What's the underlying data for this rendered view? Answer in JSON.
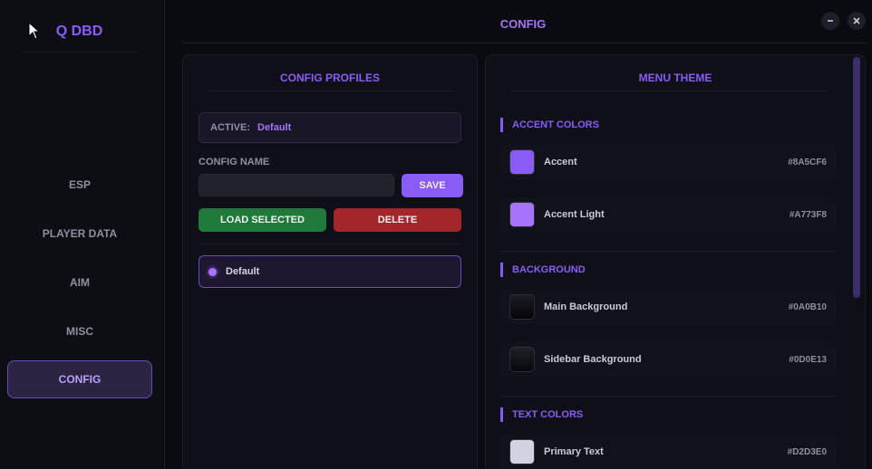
{
  "app": {
    "logo": "Q DBD"
  },
  "sidebar": {
    "items": [
      {
        "label": "ESP"
      },
      {
        "label": "PLAYER DATA"
      },
      {
        "label": "AIM"
      },
      {
        "label": "MISC"
      },
      {
        "label": "CONFIG",
        "active": true
      }
    ]
  },
  "header": {
    "title": "CONFIG"
  },
  "profiles": {
    "title": "CONFIG PROFILES",
    "active_label": "ACTIVE:",
    "active_value": "Default",
    "config_name_label": "CONFIG NAME",
    "config_name_value": "",
    "save_label": "SAVE",
    "load_label": "LOAD SELECTED",
    "delete_label": "DELETE",
    "list": [
      {
        "name": "Default",
        "selected": true
      }
    ]
  },
  "theme": {
    "title": "MENU THEME",
    "sections": [
      {
        "title": "ACCENT COLORS",
        "rows": [
          {
            "label": "Accent",
            "hex": "#8A5CF6",
            "color": "#8A5CF6"
          },
          {
            "label": "Accent Light",
            "hex": "#A773F8",
            "color": "#A773F8"
          }
        ]
      },
      {
        "title": "BACKGROUND",
        "rows": [
          {
            "label": "Main Background",
            "hex": "#0A0B10",
            "color": "#0A0B10"
          },
          {
            "label": "Sidebar Background",
            "hex": "#0D0E13",
            "color": "#0D0E13"
          }
        ]
      },
      {
        "title": "TEXT COLORS",
        "rows": [
          {
            "label": "Primary Text",
            "hex": "#D2D3E0",
            "color": "#D2D3E0"
          }
        ]
      }
    ]
  },
  "colors": {
    "accent": "#8A5CF6",
    "accent_light": "#A773F8",
    "save_button": "#8A5CF6",
    "load_button": "#1f7a3a",
    "delete_button": "#a3262a"
  },
  "icons": {
    "cursor": "mouse-cursor-icon",
    "minimize": "minimize-icon",
    "close": "close-icon",
    "profile_dot": "radio-dot-icon"
  }
}
